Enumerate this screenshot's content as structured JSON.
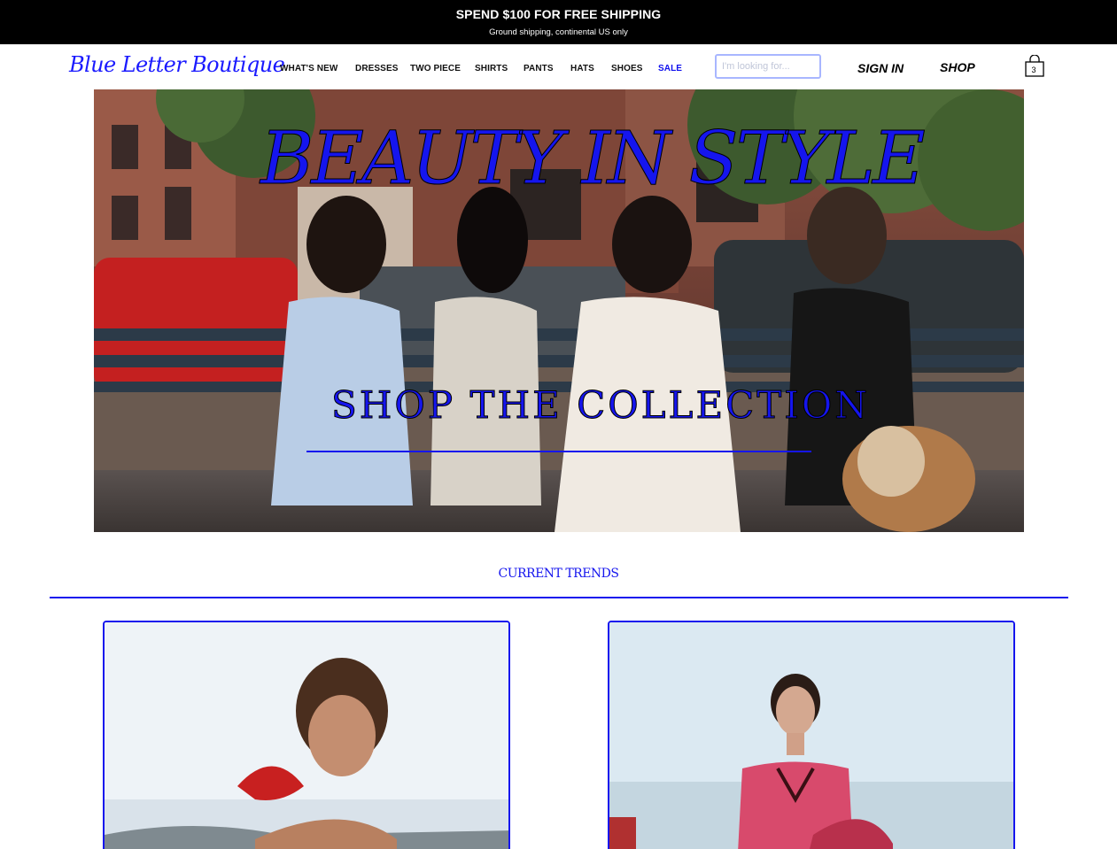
{
  "announcement": {
    "title": "SPEND $100 FOR FREE SHIPPING",
    "subtitle": "Ground shipping, continental US only"
  },
  "header": {
    "logo": "Blue Letter Boutique",
    "nav": [
      "WHAT'S NEW",
      "DRESSES",
      "TWO PIECE",
      "SHIRTS",
      "PANTS",
      "HATS",
      "SHOES",
      "SALE"
    ],
    "search_placeholder": "I'm looking for...",
    "sign_in": "SIGN IN",
    "shop": "SHOP",
    "cart_count": "3",
    "cart_icon": "shopping-bag-icon"
  },
  "hero": {
    "title": "BEAUTY IN STYLE",
    "cta": "SHOP THE COLLECTION"
  },
  "trends": {
    "title": "CURRENT TRENDS"
  },
  "colors": {
    "accent": "#1515ee",
    "topbar": "#000000"
  }
}
